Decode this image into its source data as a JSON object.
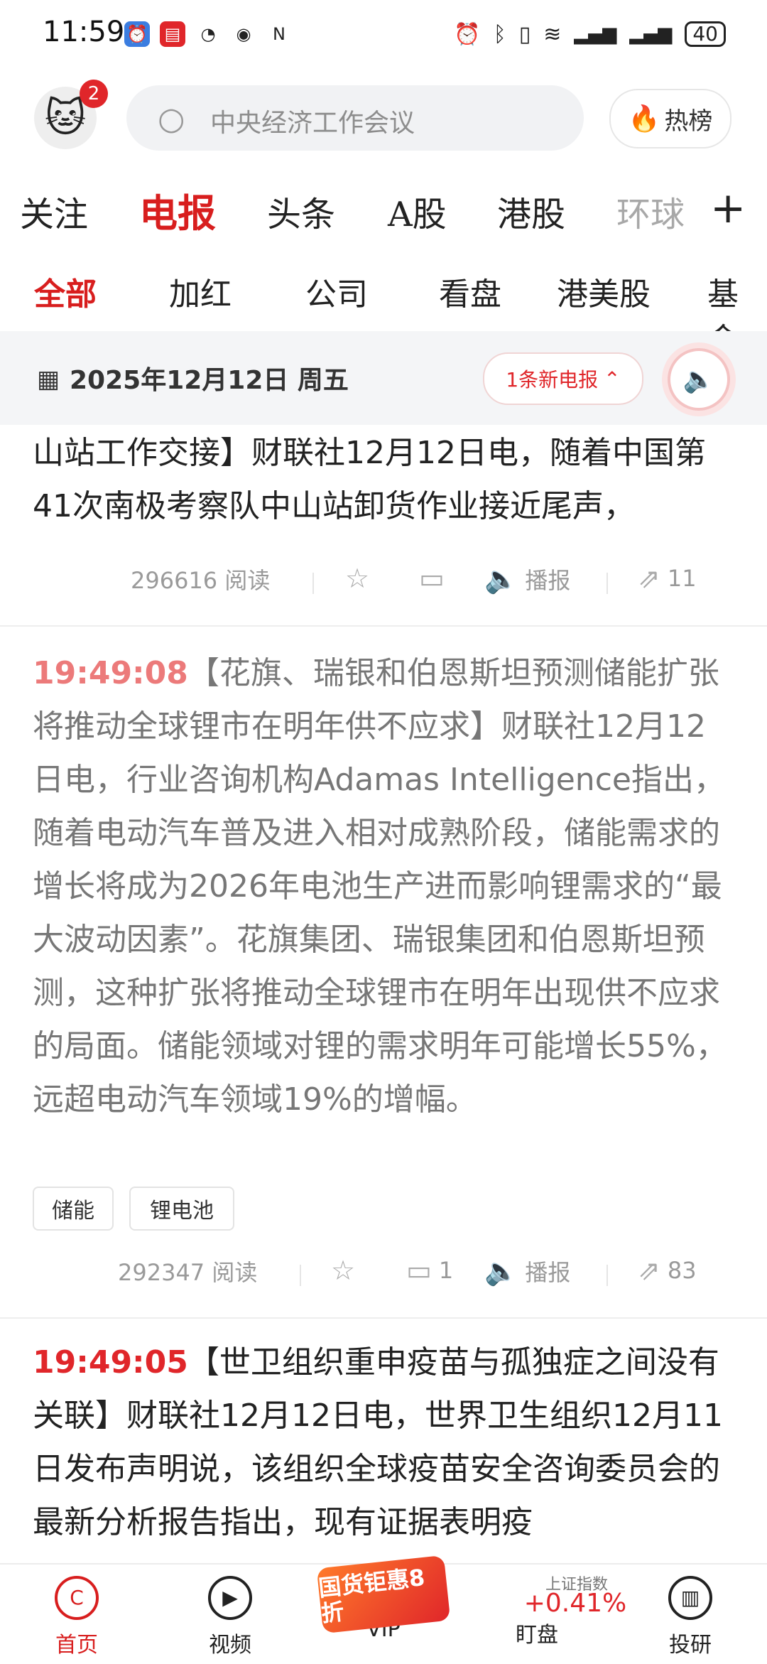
{
  "status_bar": {
    "time": "11:59",
    "battery": "40",
    "left_icons": [
      "shield-icon",
      "book-icon",
      "speedometer-icon",
      "eye-icon",
      "nfc-icon"
    ],
    "right_icons": [
      "alarm-icon",
      "bluetooth-icon",
      "vibrate-icon",
      "wifi-icon",
      "signal-4g-icon",
      "signal-4g-icon-2"
    ]
  },
  "header": {
    "notification_count": "2",
    "search_placeholder": "中央经济工作会议",
    "hot_label": "热榜"
  },
  "main_tabs": [
    "关注",
    "电报",
    "头条",
    "A股",
    "港股",
    "环球"
  ],
  "active_main_tab": "电报",
  "plus_label": "+",
  "sub_tabs": [
    "全部",
    "加红",
    "公司",
    "看盘",
    "港美股",
    "基金"
  ],
  "active_sub_tab": "全部",
  "date_bar": {
    "date": "2025年12月12日 周五",
    "new_telegram_label": "1条新电报"
  },
  "feed": [
    {
      "text": "山站工作交接】财联社12月12日电，随着中国第41次南极考察队中山站卸货作业接近尾声，",
      "reads": "296616 阅读",
      "comments": "",
      "broadcast": "播报",
      "shares": "11"
    },
    {
      "time": "19:49:08",
      "text": "【花旗、瑞银和伯恩斯坦预测储能扩张将推动全球锂市在明年供不应求】财联社12月12日电，行业咨询机构Adamas Intelligence指出，随着电动汽车普及进入相对成熟阶段，储能需求的增长将成为2026年电池生产进而影响锂需求的“最大波动因素”。花旗集团、瑞银集团和伯恩斯坦预测，这种扩张将推动全球锂市在明年出现供不应求的局面。储能领域对锂的需求明年可能增长55%，远超电动汽车领域19%的增幅。",
      "tags": [
        "储能",
        "锂电池"
      ],
      "reads": "292347 阅读",
      "comments": "1",
      "broadcast": "播报",
      "shares": "83"
    },
    {
      "time": "19:49:05",
      "text": "【世卫组织重申疫苗与孤独症之间没有关联】财联社12月12日电，世界卫生组织12月11日发布声明说，该组织全球疫苗安全咨询委员会的最新分析报告指出，现有证据表明疫"
    }
  ],
  "bottom_nav": {
    "items": [
      "首页",
      "视频",
      "VIP",
      "盯盘",
      "投研"
    ],
    "active": "首页",
    "vip_badge": "国货钜惠8折",
    "index_name": "上证指数",
    "index_change": "+0.41%"
  },
  "colors": {
    "accent": "#e0262a",
    "timestamp_faded": "#ec7a7a",
    "gray_text": "#777777"
  }
}
